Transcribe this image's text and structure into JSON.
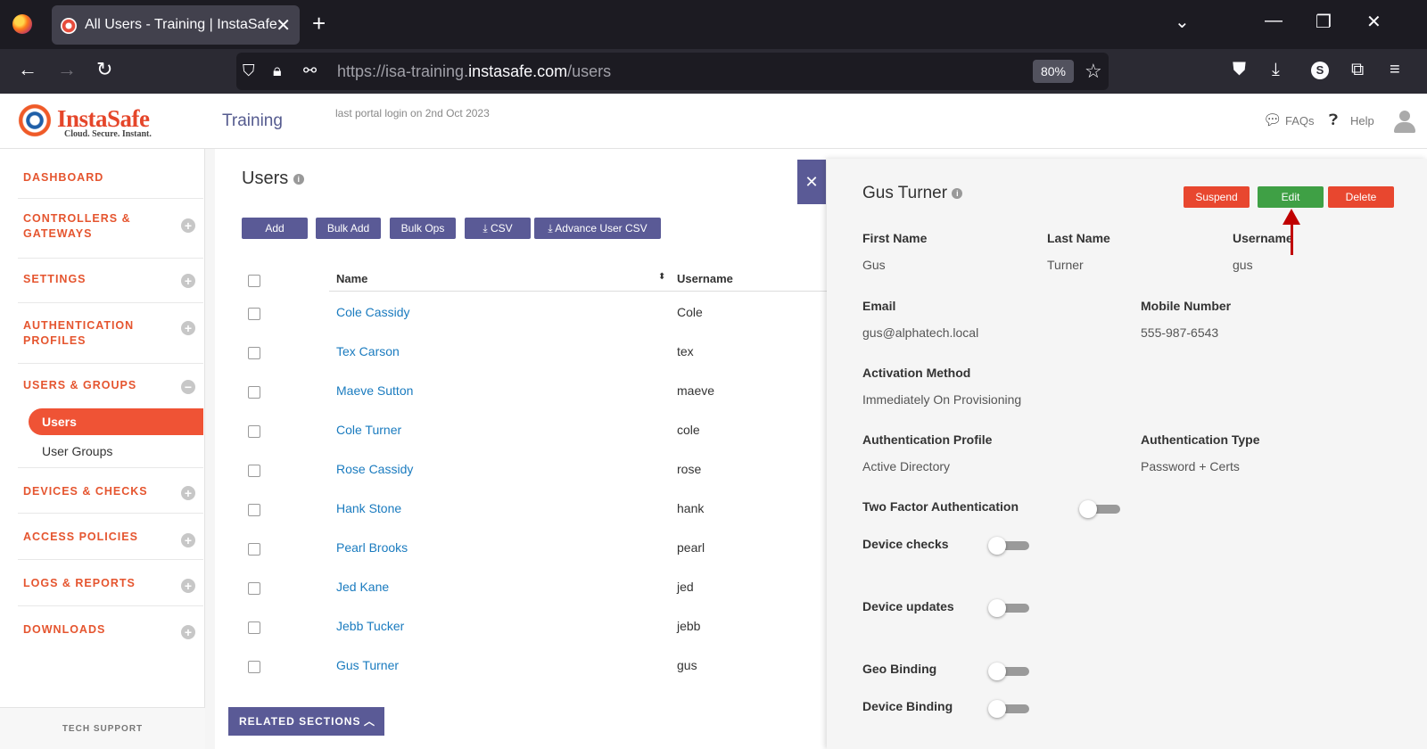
{
  "browser": {
    "tab_title": "All Users - Training | InstaSafe",
    "url_prefix": "https://isa-training.",
    "url_domain": "instasafe.com",
    "url_path": "/users",
    "zoom": "80%",
    "profile_letter": "S"
  },
  "header": {
    "logo_text": "InstaSafe",
    "logo_tagline": "Cloud. Secure. Instant.",
    "tenant": "Training",
    "last_login": "last portal login on 2nd Oct 2023",
    "faqs": "FAQs",
    "help": "Help"
  },
  "sidebar": {
    "dashboard": "DASHBOARD",
    "controllers_l1": "CONTROLLERS &",
    "controllers_l2": "GATEWAYS",
    "settings": "SETTINGS",
    "auth_l1": "AUTHENTICATION",
    "auth_l2": "PROFILES",
    "users_groups": "USERS & GROUPS",
    "users": "Users",
    "user_groups": "User Groups",
    "devices": "DEVICES & CHECKS",
    "access": "ACCESS POLICIES",
    "logs": "LOGS & REPORTS",
    "downloads": "DOWNLOADS",
    "tech_support": "TECH SUPPORT"
  },
  "main": {
    "title": "Users",
    "buttons": {
      "add": "Add",
      "bulk_add": "Bulk Add",
      "bulk_ops": "Bulk Ops",
      "csv": "CSV",
      "advance_csv": "Advance User CSV"
    },
    "columns": {
      "name": "Name",
      "username": "Username"
    },
    "rows": [
      {
        "name": "Cole Cassidy",
        "username": "Cole"
      },
      {
        "name": "Tex Carson",
        "username": "tex"
      },
      {
        "name": "Maeve Sutton",
        "username": "maeve"
      },
      {
        "name": "Cole Turner",
        "username": "cole"
      },
      {
        "name": "Rose Cassidy",
        "username": "rose"
      },
      {
        "name": "Hank Stone",
        "username": "hank"
      },
      {
        "name": "Pearl Brooks",
        "username": "pearl"
      },
      {
        "name": "Jed Kane",
        "username": "jed"
      },
      {
        "name": "Jebb Tucker",
        "username": "jebb"
      },
      {
        "name": "Gus Turner",
        "username": "gus"
      }
    ],
    "related_sections": "RELATED SECTIONS"
  },
  "panel": {
    "title": "Gus Turner",
    "suspend": "Suspend",
    "edit": "Edit",
    "delete": "Delete",
    "first_name_label": "First Name",
    "first_name": "Gus",
    "last_name_label": "Last Name",
    "last_name": "Turner",
    "username_label": "Username",
    "username": "gus",
    "email_label": "Email",
    "email": "gus@alphatech.local",
    "mobile_label": "Mobile Number",
    "mobile": "555-987-6543",
    "activation_label": "Activation Method",
    "activation": "Immediately On Provisioning",
    "auth_profile_label": "Authentication Profile",
    "auth_profile": "Active Directory",
    "auth_type_label": "Authentication Type",
    "auth_type": "Password + Certs",
    "two_factor": "Two Factor Authentication",
    "device_checks": "Device checks",
    "device_updates": "Device updates",
    "geo_binding": "Geo Binding",
    "device_binding": "Device Binding",
    "toggles": {
      "two_factor": false,
      "device_checks": false,
      "device_updates": false,
      "geo_binding": false,
      "device_binding": false
    }
  },
  "colors": {
    "accent_orange": "#ef5335",
    "purple_button": "#5a5a96",
    "edit_green": "#3fa045",
    "danger_red": "#e8472f",
    "link_blue": "#1a7bbf"
  }
}
